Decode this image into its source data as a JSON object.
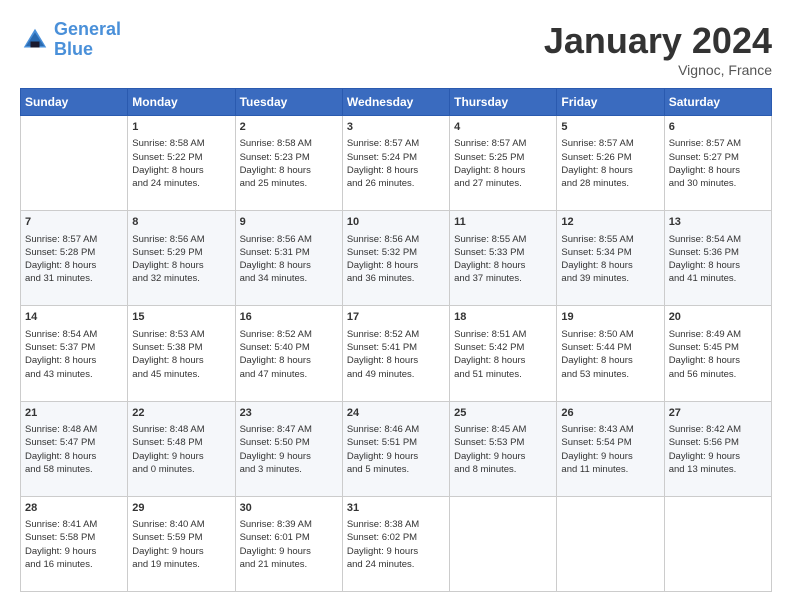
{
  "logo": {
    "text1": "General",
    "text2": "Blue"
  },
  "title": "January 2024",
  "location": "Vignoc, France",
  "days_header": [
    "Sunday",
    "Monday",
    "Tuesday",
    "Wednesday",
    "Thursday",
    "Friday",
    "Saturday"
  ],
  "weeks": [
    [
      {
        "day": "",
        "info": ""
      },
      {
        "day": "1",
        "info": "Sunrise: 8:58 AM\nSunset: 5:22 PM\nDaylight: 8 hours\nand 24 minutes."
      },
      {
        "day": "2",
        "info": "Sunrise: 8:58 AM\nSunset: 5:23 PM\nDaylight: 8 hours\nand 25 minutes."
      },
      {
        "day": "3",
        "info": "Sunrise: 8:57 AM\nSunset: 5:24 PM\nDaylight: 8 hours\nand 26 minutes."
      },
      {
        "day": "4",
        "info": "Sunrise: 8:57 AM\nSunset: 5:25 PM\nDaylight: 8 hours\nand 27 minutes."
      },
      {
        "day": "5",
        "info": "Sunrise: 8:57 AM\nSunset: 5:26 PM\nDaylight: 8 hours\nand 28 minutes."
      },
      {
        "day": "6",
        "info": "Sunrise: 8:57 AM\nSunset: 5:27 PM\nDaylight: 8 hours\nand 30 minutes."
      }
    ],
    [
      {
        "day": "7",
        "info": "Sunrise: 8:57 AM\nSunset: 5:28 PM\nDaylight: 8 hours\nand 31 minutes."
      },
      {
        "day": "8",
        "info": "Sunrise: 8:56 AM\nSunset: 5:29 PM\nDaylight: 8 hours\nand 32 minutes."
      },
      {
        "day": "9",
        "info": "Sunrise: 8:56 AM\nSunset: 5:31 PM\nDaylight: 8 hours\nand 34 minutes."
      },
      {
        "day": "10",
        "info": "Sunrise: 8:56 AM\nSunset: 5:32 PM\nDaylight: 8 hours\nand 36 minutes."
      },
      {
        "day": "11",
        "info": "Sunrise: 8:55 AM\nSunset: 5:33 PM\nDaylight: 8 hours\nand 37 minutes."
      },
      {
        "day": "12",
        "info": "Sunrise: 8:55 AM\nSunset: 5:34 PM\nDaylight: 8 hours\nand 39 minutes."
      },
      {
        "day": "13",
        "info": "Sunrise: 8:54 AM\nSunset: 5:36 PM\nDaylight: 8 hours\nand 41 minutes."
      }
    ],
    [
      {
        "day": "14",
        "info": "Sunrise: 8:54 AM\nSunset: 5:37 PM\nDaylight: 8 hours\nand 43 minutes."
      },
      {
        "day": "15",
        "info": "Sunrise: 8:53 AM\nSunset: 5:38 PM\nDaylight: 8 hours\nand 45 minutes."
      },
      {
        "day": "16",
        "info": "Sunrise: 8:52 AM\nSunset: 5:40 PM\nDaylight: 8 hours\nand 47 minutes."
      },
      {
        "day": "17",
        "info": "Sunrise: 8:52 AM\nSunset: 5:41 PM\nDaylight: 8 hours\nand 49 minutes."
      },
      {
        "day": "18",
        "info": "Sunrise: 8:51 AM\nSunset: 5:42 PM\nDaylight: 8 hours\nand 51 minutes."
      },
      {
        "day": "19",
        "info": "Sunrise: 8:50 AM\nSunset: 5:44 PM\nDaylight: 8 hours\nand 53 minutes."
      },
      {
        "day": "20",
        "info": "Sunrise: 8:49 AM\nSunset: 5:45 PM\nDaylight: 8 hours\nand 56 minutes."
      }
    ],
    [
      {
        "day": "21",
        "info": "Sunrise: 8:48 AM\nSunset: 5:47 PM\nDaylight: 8 hours\nand 58 minutes."
      },
      {
        "day": "22",
        "info": "Sunrise: 8:48 AM\nSunset: 5:48 PM\nDaylight: 9 hours\nand 0 minutes."
      },
      {
        "day": "23",
        "info": "Sunrise: 8:47 AM\nSunset: 5:50 PM\nDaylight: 9 hours\nand 3 minutes."
      },
      {
        "day": "24",
        "info": "Sunrise: 8:46 AM\nSunset: 5:51 PM\nDaylight: 9 hours\nand 5 minutes."
      },
      {
        "day": "25",
        "info": "Sunrise: 8:45 AM\nSunset: 5:53 PM\nDaylight: 9 hours\nand 8 minutes."
      },
      {
        "day": "26",
        "info": "Sunrise: 8:43 AM\nSunset: 5:54 PM\nDaylight: 9 hours\nand 11 minutes."
      },
      {
        "day": "27",
        "info": "Sunrise: 8:42 AM\nSunset: 5:56 PM\nDaylight: 9 hours\nand 13 minutes."
      }
    ],
    [
      {
        "day": "28",
        "info": "Sunrise: 8:41 AM\nSunset: 5:58 PM\nDaylight: 9 hours\nand 16 minutes."
      },
      {
        "day": "29",
        "info": "Sunrise: 8:40 AM\nSunset: 5:59 PM\nDaylight: 9 hours\nand 19 minutes."
      },
      {
        "day": "30",
        "info": "Sunrise: 8:39 AM\nSunset: 6:01 PM\nDaylight: 9 hours\nand 21 minutes."
      },
      {
        "day": "31",
        "info": "Sunrise: 8:38 AM\nSunset: 6:02 PM\nDaylight: 9 hours\nand 24 minutes."
      },
      {
        "day": "",
        "info": ""
      },
      {
        "day": "",
        "info": ""
      },
      {
        "day": "",
        "info": ""
      }
    ]
  ]
}
